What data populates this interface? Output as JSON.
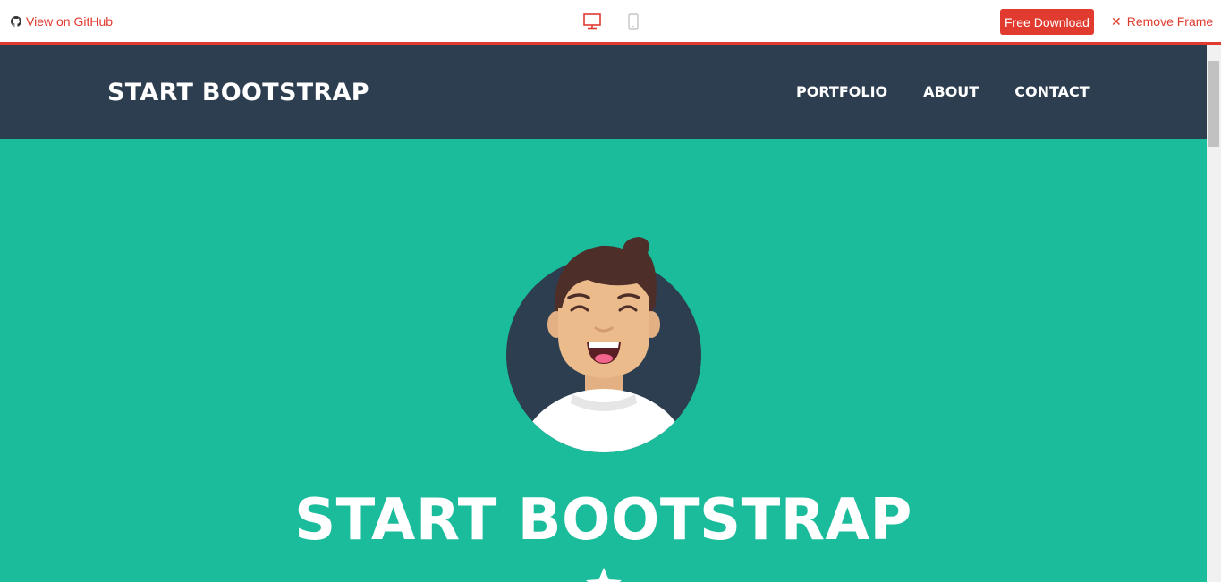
{
  "frame_bar": {
    "github_label": "View on GitHub",
    "free_download_label": "Free Download",
    "remove_frame_label": "Remove Frame",
    "accent_color": "#e13a2f",
    "icons": [
      "github-icon",
      "desktop-icon",
      "mobile-icon",
      "close-icon"
    ]
  },
  "site": {
    "brand": "START BOOTSTRAP",
    "nav": [
      "PORTFOLIO",
      "ABOUT",
      "CONTACT"
    ],
    "masthead_heading": "START BOOTSTRAP",
    "colors": {
      "navbar": "#2c3e50",
      "masthead": "#1abc9c",
      "text": "#ffffff"
    },
    "icons": [
      "avatar",
      "star-icon"
    ]
  }
}
